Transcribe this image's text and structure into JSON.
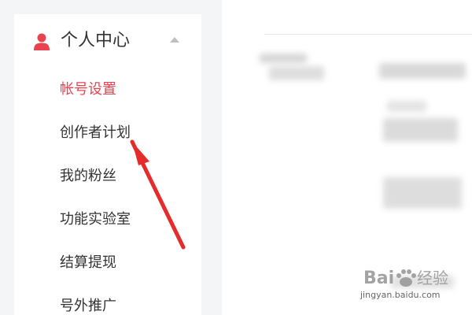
{
  "sidebar": {
    "section_title": "个人中心",
    "items": [
      {
        "label": "帐号设置",
        "active": true
      },
      {
        "label": "创作者计划",
        "active": false
      },
      {
        "label": "我的粉丝",
        "active": false
      },
      {
        "label": "功能实验室",
        "active": false
      },
      {
        "label": "结算提现",
        "active": false
      },
      {
        "label": "号外推广",
        "active": false
      }
    ]
  },
  "icons": {
    "section": "user-icon",
    "collapse": "chevron-up-icon"
  },
  "watermark": {
    "logo_text": "Baidu经验",
    "url": "jingyan.baidu.com"
  },
  "colors": {
    "accent": "#e9434f",
    "annotation_arrow": "#e52b2b",
    "text": "#333333"
  }
}
